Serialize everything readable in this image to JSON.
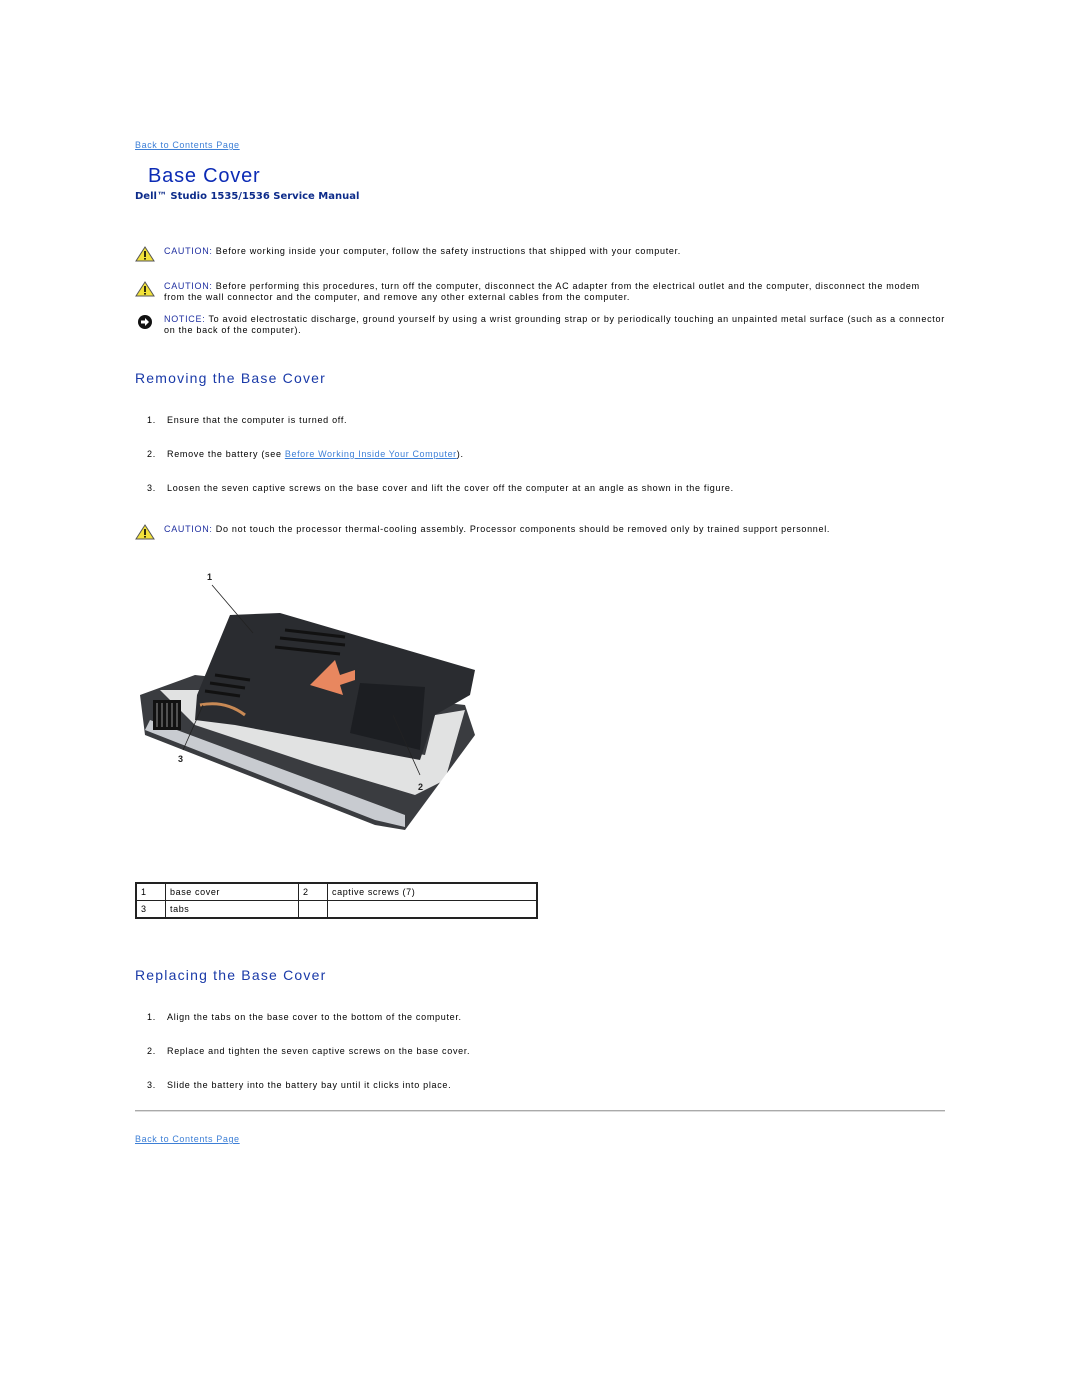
{
  "nav": {
    "back_to_contents": "Back to Contents Page"
  },
  "header": {
    "title": "Base Cover",
    "subtitle": "Dell™ Studio 1535/1536 Service Manual"
  },
  "notices": [
    {
      "type": "caution",
      "icon": "warning-triangle-icon",
      "label": "CAUTION:",
      "text": " Before working inside your computer, follow the safety instructions that shipped with your computer."
    },
    {
      "type": "caution",
      "icon": "warning-triangle-icon",
      "label": "CAUTION:",
      "text": " Before performing this procedures, turn off the computer, disconnect the AC adapter from the electrical outlet and the computer, disconnect the modem from the wall connector and the computer, and remove any other external cables from the computer."
    },
    {
      "type": "notice",
      "icon": "notice-arrow-icon",
      "label": "NOTICE:",
      "text": " To avoid electrostatic discharge, ground yourself by using a wrist grounding strap or by periodically touching an unpainted metal surface (such as a connector on the back of the computer)."
    }
  ],
  "removing": {
    "heading": "Removing the Base Cover",
    "steps": [
      {
        "num": "1.",
        "text": "Ensure that the computer is turned off."
      },
      {
        "num": "2.",
        "text_before": "Remove the battery (see ",
        "link": "Before Working Inside Your Computer",
        "text_after": ")."
      },
      {
        "num": "3.",
        "text": "Loosen the seven captive screws on the base cover and lift the cover off the computer at an angle as shown in the figure."
      }
    ],
    "caution": {
      "label": "CAUTION:",
      "text": " Do not touch the processor thermal-cooling assembly. Processor components should be removed only by trained support personnel."
    },
    "figure_callouts": [
      "1",
      "2",
      "3"
    ]
  },
  "legend_table": {
    "rows": [
      [
        "1",
        "base cover",
        "2",
        "captive screws (7)"
      ],
      [
        "3",
        "tabs",
        "",
        ""
      ]
    ]
  },
  "replacing": {
    "heading": "Replacing the Base Cover",
    "steps": [
      {
        "num": "1.",
        "text": "Align the tabs on the base cover to the bottom of the computer."
      },
      {
        "num": "2.",
        "text": "Replace and tighten the seven captive screws on the base cover."
      },
      {
        "num": "3.",
        "text": "Slide the battery into the battery bay until it clicks into place."
      }
    ]
  }
}
